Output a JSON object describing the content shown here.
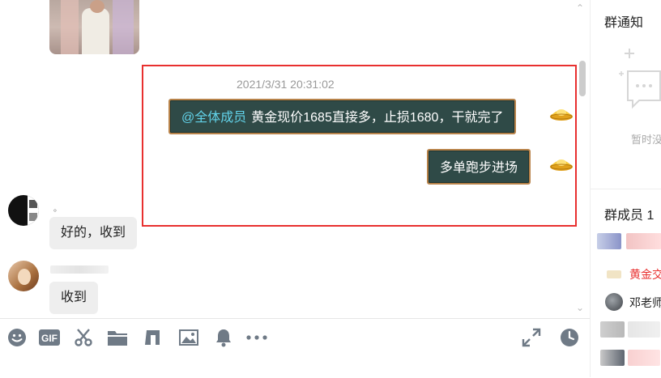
{
  "chat": {
    "timestamp": "2021/3/31 20:31:02",
    "messages": [
      {
        "mention": "@全体成员",
        "text": "黄金现价1685直接多，止损1680，干就完了"
      },
      {
        "text": "多单跑步进场"
      },
      {
        "sender_name": "。",
        "text": "好的，收到"
      },
      {
        "text": "收到"
      }
    ],
    "colors": {
      "highlight_border": "#e8302f",
      "bubble_dark": "#2f4a47",
      "bubble_border": "#b8834a",
      "mention": "#62d3ea"
    }
  },
  "sidebar": {
    "notice_title": "群通知",
    "notice_empty_text": "暂时没",
    "members_title": "群成员 1",
    "members": [
      {
        "name": ""
      },
      {
        "name": "黄金交"
      },
      {
        "name": "邓老师"
      },
      {
        "name": ""
      },
      {
        "name": ""
      }
    ]
  },
  "toolbar": {
    "icons": [
      "emoji-icon",
      "gif-icon",
      "screenshot-scissors-icon",
      "folder-icon",
      "music-icon",
      "image-icon",
      "bell-icon",
      "more-icon",
      "expand-icon",
      "history-clock-icon"
    ],
    "gif_label": "GIF"
  }
}
